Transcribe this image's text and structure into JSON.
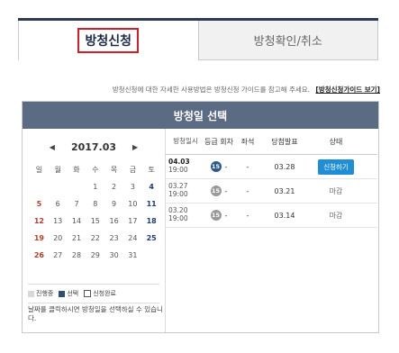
{
  "tabs": {
    "apply": "방청신청",
    "confirm": "방청확인/취소"
  },
  "guide": {
    "text": "방청신청에 대한 자세한 사용방법은 방청신청 가이드를 참고해 주세요.",
    "link": "[방청신청가이드 보기]"
  },
  "panel": {
    "title": "방청일 선택"
  },
  "calendar": {
    "month": "2017.03",
    "prev": "◀",
    "next": "▶",
    "weekdays": [
      "일",
      "월",
      "화",
      "수",
      "목",
      "금",
      "토"
    ],
    "weeks": [
      [
        "",
        "",
        "",
        "1",
        "2",
        "3",
        "4"
      ],
      [
        "5",
        "6",
        "7",
        "8",
        "9",
        "10",
        "11"
      ],
      [
        "12",
        "13",
        "14",
        "15",
        "16",
        "17",
        "18"
      ],
      [
        "19",
        "20",
        "21",
        "22",
        "23",
        "24",
        "25"
      ],
      [
        "26",
        "27",
        "28",
        "29",
        "30",
        "31",
        ""
      ]
    ]
  },
  "legend": {
    "in_progress": "진행중",
    "selected": "선택",
    "finished": "신청완료"
  },
  "note": "날짜를 클릭하시면 방청일을 선택하실 수 있습니다.",
  "table": {
    "headers": [
      "방청일시",
      "등급",
      "회차",
      "좌석",
      "당첨발표",
      "상태"
    ],
    "rows": [
      {
        "date": "04.03",
        "time": "19:00",
        "grade": "15",
        "round": "-",
        "seat": "-",
        "announce": "03.28",
        "status": "신청하기"
      },
      {
        "date": "03.27",
        "time": "19:00",
        "grade": "15",
        "round": "-",
        "seat": "-",
        "announce": "03.21",
        "status": "마감"
      },
      {
        "date": "03.20",
        "time": "19:00",
        "grade": "15",
        "round": "-",
        "seat": "-",
        "announce": "03.14",
        "status": "마감"
      }
    ]
  }
}
